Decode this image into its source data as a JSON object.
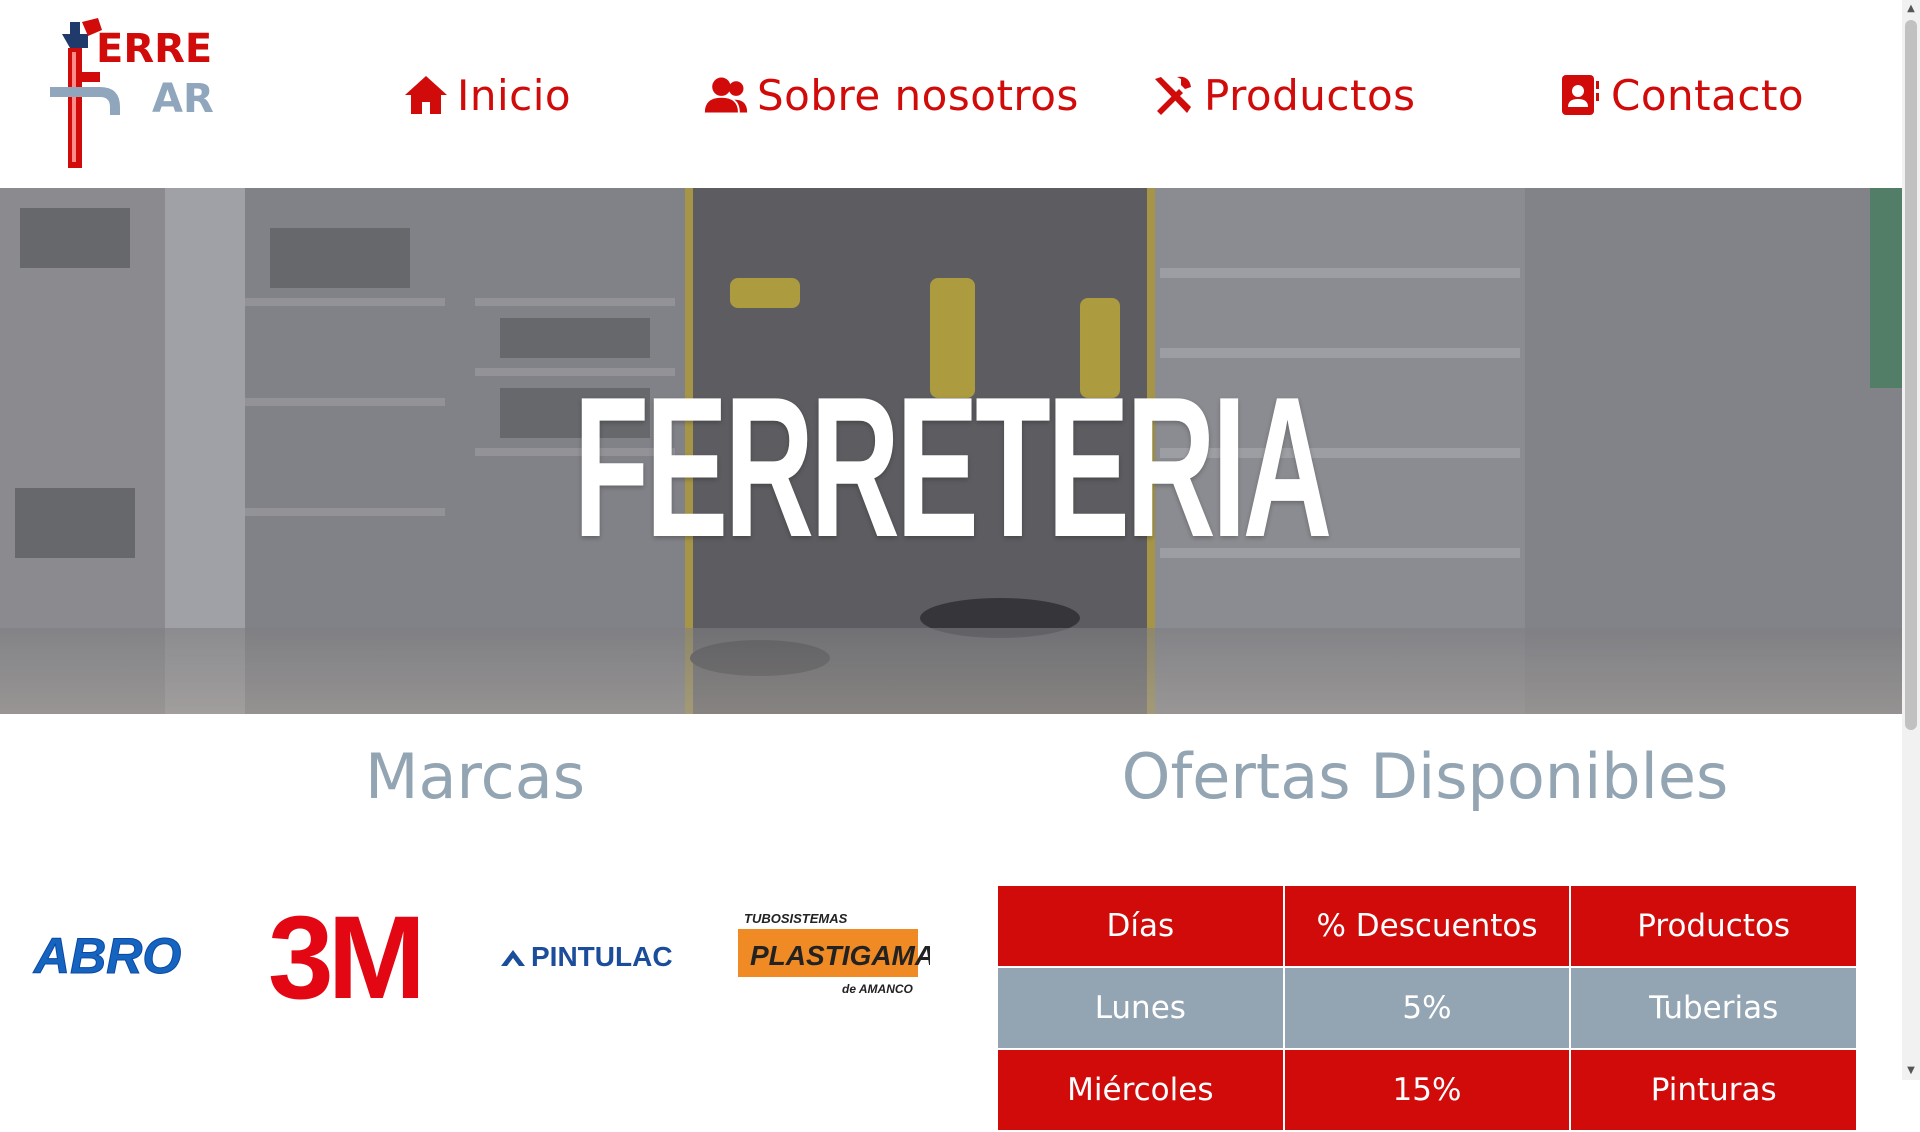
{
  "header": {
    "logo_text_line1": "ERRE",
    "logo_text_line2": "AR",
    "nav": [
      {
        "label": "Inicio",
        "icon": "home-icon"
      },
      {
        "label": "Sobre nosotros",
        "icon": "users-icon"
      },
      {
        "label": "Productos",
        "icon": "tools-icon"
      },
      {
        "label": "Contacto",
        "icon": "contact-card-icon"
      }
    ]
  },
  "hero": {
    "title": "FERRETERIA"
  },
  "brands_section": {
    "title": "Marcas",
    "brands": [
      {
        "name": "ABRO"
      },
      {
        "name": "3M"
      },
      {
        "name": "PINTULAC"
      },
      {
        "name": "PLASTIGAMA",
        "top": "TUBOSISTEMAS",
        "bottom": "de AMANCO"
      }
    ]
  },
  "offers_section": {
    "title": "Ofertas Disponibles",
    "headers": [
      "Días",
      "% Descuentos",
      "Productos"
    ],
    "rows": [
      [
        "Lunes",
        "5%",
        "Tuberias"
      ],
      [
        "Miércoles",
        "15%",
        "Pinturas"
      ]
    ]
  },
  "colors": {
    "accent": "#d10a0a",
    "muted": "#93a4b3"
  }
}
